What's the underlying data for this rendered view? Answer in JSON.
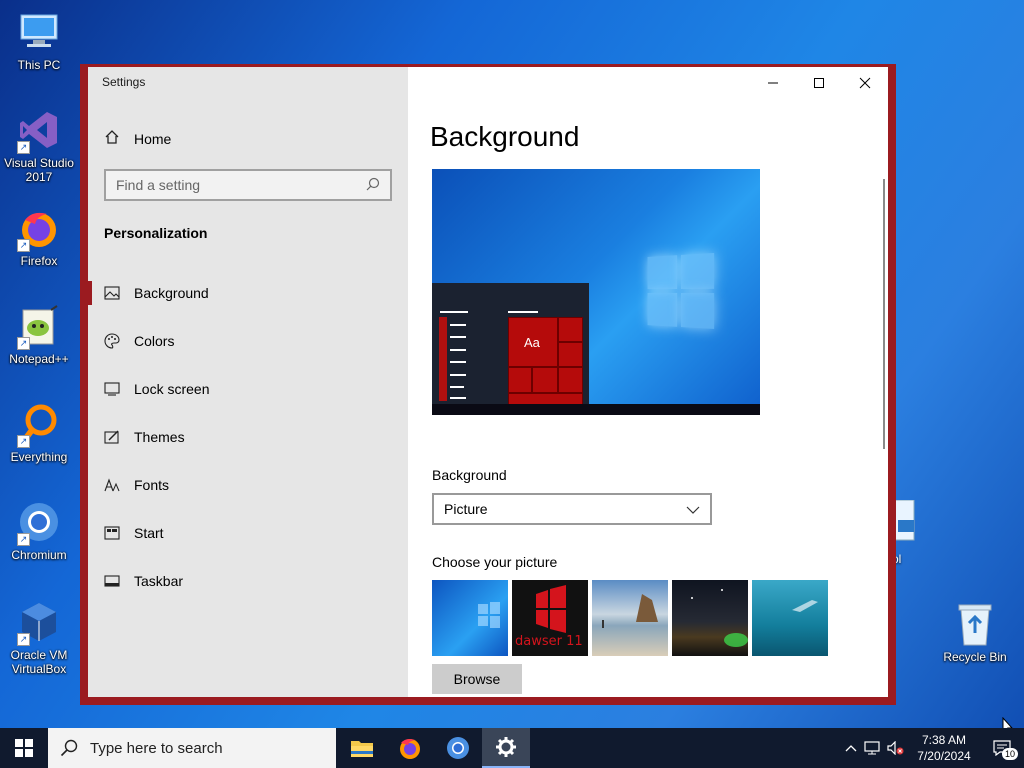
{
  "desktop": {
    "icons": [
      {
        "label": "This PC",
        "icon": "computer-icon"
      },
      {
        "label": "Visual Studio 2017",
        "icon": "visual-studio-icon"
      },
      {
        "label": "Firefox",
        "icon": "firefox-icon"
      },
      {
        "label": "Notepad++",
        "icon": "notepadpp-icon"
      },
      {
        "label": "Everything",
        "icon": "everything-icon"
      },
      {
        "label": "Chromium",
        "icon": "chromium-icon"
      },
      {
        "label": "Oracle VM VirtualBox",
        "icon": "virtualbox-icon"
      },
      {
        "label": "Recycle Bin",
        "icon": "recycle-bin-icon"
      }
    ],
    "partial_label": "ol"
  },
  "window": {
    "title": "Settings",
    "home": "Home",
    "search_placeholder": "Find a setting",
    "section": "Personalization",
    "nav": [
      {
        "label": "Background",
        "icon": "image-icon",
        "active": true
      },
      {
        "label": "Colors",
        "icon": "palette-icon"
      },
      {
        "label": "Lock screen",
        "icon": "lock-screen-icon"
      },
      {
        "label": "Themes",
        "icon": "themes-icon"
      },
      {
        "label": "Fonts",
        "icon": "fonts-icon"
      },
      {
        "label": "Start",
        "icon": "start-icon"
      },
      {
        "label": "Taskbar",
        "icon": "taskbar-icon"
      }
    ],
    "accent": "#9b1b20"
  },
  "main": {
    "title": "Background",
    "preview_text": "Aa",
    "background_label": "Background",
    "background_value": "Picture",
    "choose_label": "Choose your picture",
    "thumb_text": "dawser 11",
    "browse": "Browse"
  },
  "taskbar": {
    "search": "Type here to search",
    "time": "7:38 AM",
    "date": "7/20/2024",
    "notifications": "10"
  }
}
